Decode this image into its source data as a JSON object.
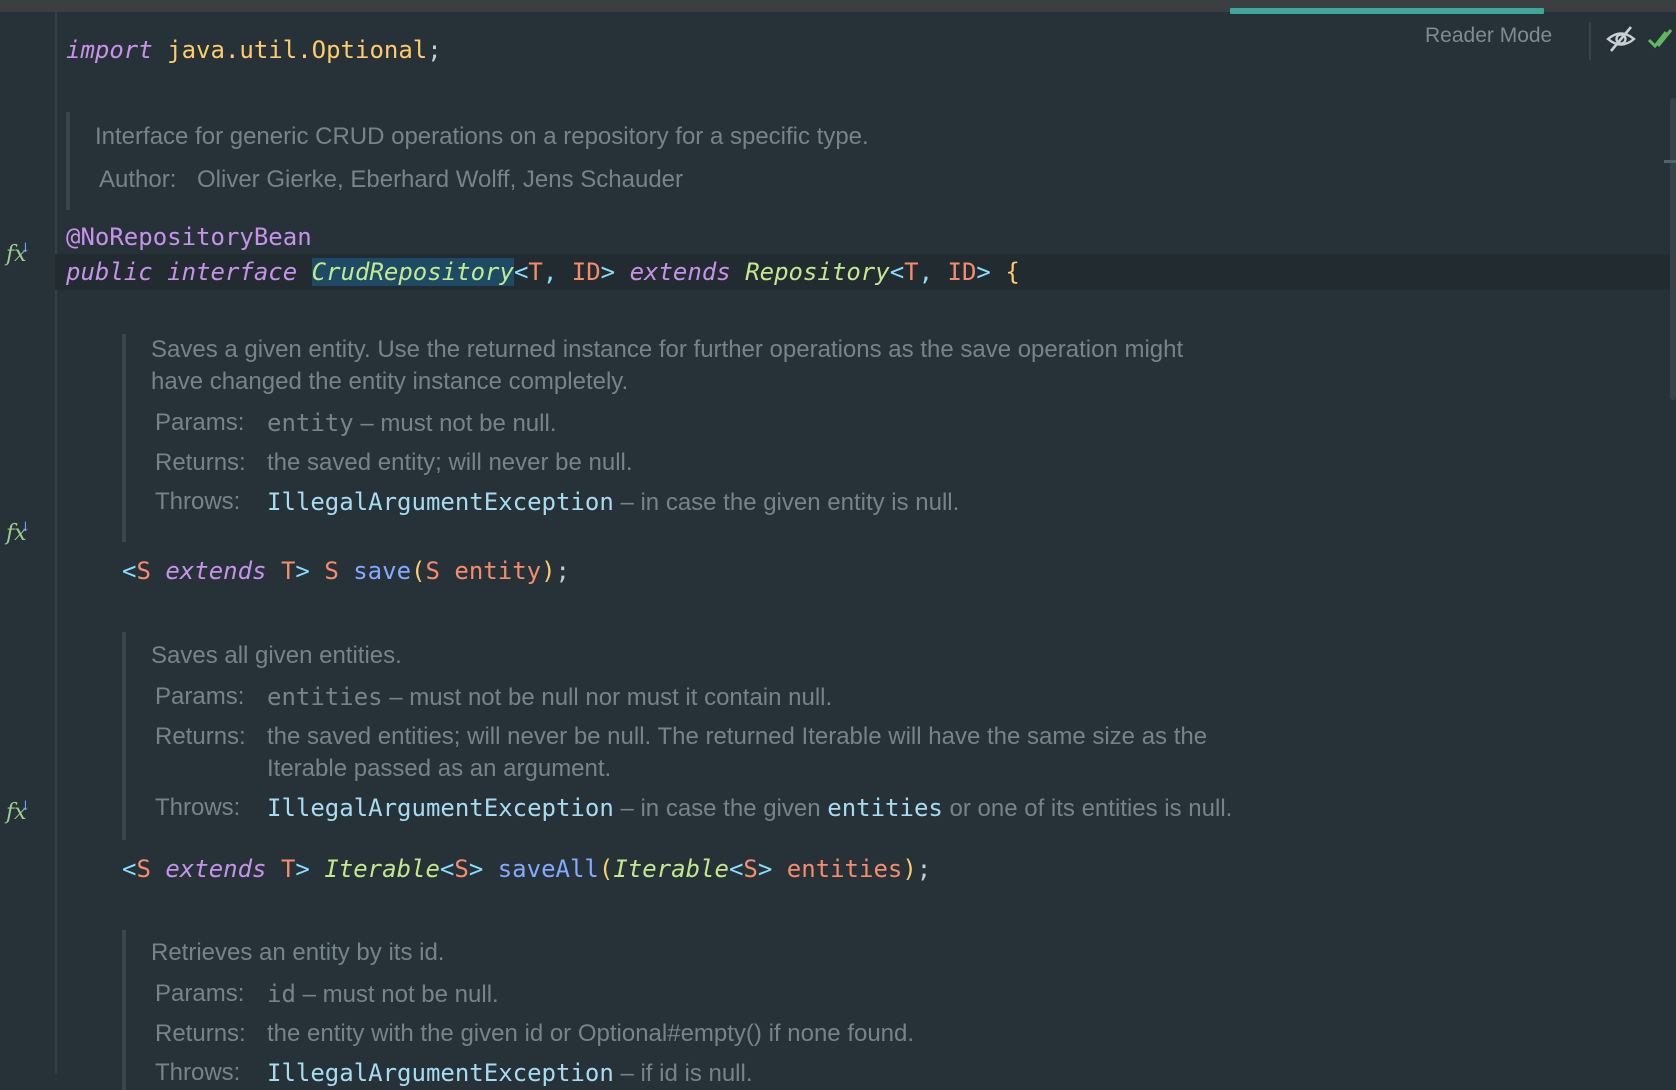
{
  "toolbar": {
    "reader_mode": "Reader Mode",
    "toggle_icon": "eye-crossed-icon",
    "status_icon": "double-check-icon"
  },
  "colors": {
    "background": "#263238",
    "keyword": "#c792ea",
    "class": "#ffcb6b",
    "type_param": "#f78c6c",
    "function": "#82aaff",
    "doc_text": "#76838b",
    "tab_accent": "#3fa69a"
  },
  "code": {
    "import_kw": "import",
    "import_path": "java.util.Optional",
    "semicolon": ";",
    "annotation": "@NoRepositoryBean",
    "decl": {
      "public": "public",
      "interface": "interface",
      "name": "CrudRepository",
      "generics_open": "<",
      "t": "T",
      "comma": ", ",
      "id": "ID",
      "generics_close": ">",
      "extends": "extends",
      "parent": "Repository",
      "brace": "{"
    },
    "save": {
      "s": "S",
      "extends": "extends",
      "t": "T",
      "name": "save",
      "param_type": "S",
      "param": "entity"
    },
    "save_all": {
      "s": "S",
      "extends": "extends",
      "t": "T",
      "iterable": "Iterable",
      "name": "saveAll",
      "param": "entities"
    }
  },
  "docs": {
    "interface": {
      "description": "Interface for generic CRUD operations on a repository for a specific type.",
      "author_label": "Author:",
      "author_value": "Oliver Gierke, Eberhard Wolff, Jens Schauder"
    },
    "save": {
      "description_1": "Saves a given entity. Use the returned instance for further operations as the save operation might",
      "description_2": "have changed the entity instance completely.",
      "params_label": "Params:",
      "params_name": "entity",
      "params_text": " – must not be null.",
      "returns_label": "Returns:",
      "returns_text": "the saved entity; will never be null.",
      "throws_label": "Throws:",
      "throws_link": "IllegalArgumentException",
      "throws_text": " – in case the given entity is null."
    },
    "save_all": {
      "description": "Saves all given entities.",
      "params_label": "Params:",
      "params_name": "entities",
      "params_text": " – must not be null nor must it contain null.",
      "returns_label": "Returns:",
      "returns_text_1": "the saved entities; will never be null. The returned Iterable will have the same size as the",
      "returns_text_2": "Iterable passed as an argument.",
      "throws_label": "Throws:",
      "throws_link": "IllegalArgumentException",
      "throws_text_a": " – in case the given ",
      "throws_link_2": "entities",
      "throws_text_b": " or one of its entities is null."
    },
    "find_by_id": {
      "description": "Retrieves an entity by its id.",
      "params_label": "Params:",
      "params_name": "id",
      "params_text": " – must not be null.",
      "returns_label": "Returns:",
      "returns_text": "the entity with the given id or Optional#empty() if none found.",
      "throws_label": "Throws:",
      "throws_link": "IllegalArgumentException",
      "throws_text": " – if id is null."
    }
  }
}
